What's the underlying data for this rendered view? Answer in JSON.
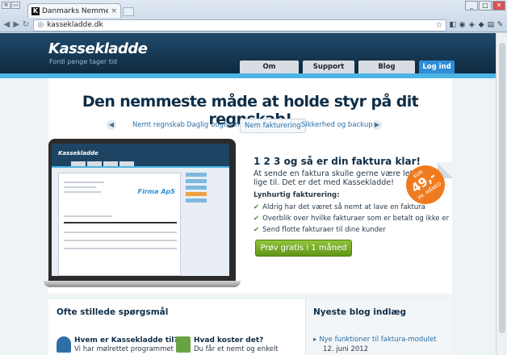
{
  "browser": {
    "tab_title": "Danmarks Nemmeste R",
    "tab_close": "×",
    "url": "kassekladde.dk",
    "back": "◀",
    "forward": "▶",
    "reload": "↻",
    "star": "☆",
    "win_minimize": "_",
    "win_maximize": "□",
    "win_close": "✕"
  },
  "header": {
    "logo": "Kassekladde",
    "tagline": "Fordi penge tager tid",
    "nav": [
      {
        "label": "Om kassekladde"
      },
      {
        "label": "Support"
      },
      {
        "label": "Blog"
      },
      {
        "label": "Log ind"
      }
    ]
  },
  "hero": {
    "headline": "Den nemmeste måde at holde styr på dit regnskab!",
    "prev_arrow": "◀",
    "next_arrow": "▶",
    "features": [
      {
        "label": "Nemt regnskab"
      },
      {
        "label": "Daglig bogføring"
      },
      {
        "label": "Nem fakturering",
        "active": true
      },
      {
        "label": "Sikkerhed og backup"
      }
    ],
    "title": "1 2 3 og så er din faktura klar!",
    "description": "At sende en faktura skulle gerne være let og lige til. Det er det med Kassekladde!",
    "subheading": "Lynhurtig fakturering:",
    "bullets": [
      "Aldrig har det været så nemt at lave en faktura",
      "Overblik over hvilke fakturaer som er betalt og ikke er",
      "Send flotte fakturaer til dine kunder"
    ],
    "cta": "Prøv gratis i 1 måned",
    "badge": {
      "top": "KUN",
      "price": "49,-",
      "bottom": "PR. MÅNED"
    }
  },
  "screen_mock": {
    "logo": "Kassekladde",
    "company": "Firma ApS"
  },
  "faq": {
    "title": "Ofte stillede spørgsmål",
    "items": [
      {
        "q": "Hvem er Kassekladde til?",
        "a": "Vi har mølrettet programmet til"
      },
      {
        "q": "Hvad koster det?",
        "a": "Du får et nemt og enkelt"
      }
    ]
  },
  "blog": {
    "title": "Nyeste blog indlæg",
    "items": [
      {
        "title": "Nye funktioner til faktura-modulet",
        "date": "12. juni 2012"
      }
    ]
  }
}
